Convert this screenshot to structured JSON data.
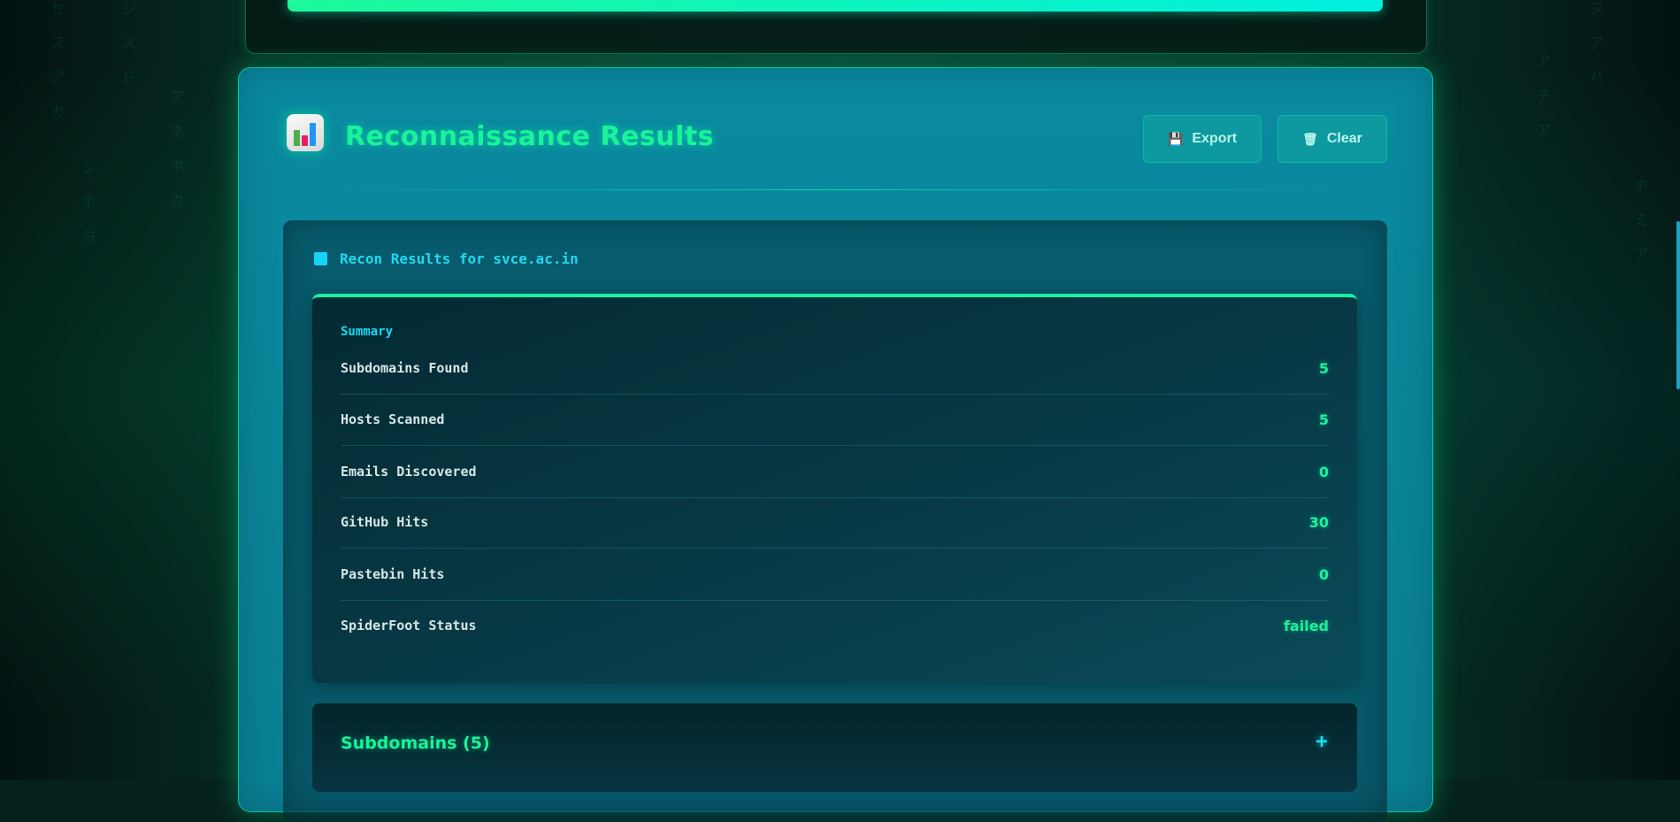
{
  "header": {
    "title": "Reconnaissance Results",
    "export_label": "Export",
    "clear_label": "Clear"
  },
  "results": {
    "heading": "Recon Results for svce.ac.in",
    "summary_label": "Summary",
    "rows": [
      {
        "label": "Subdomains Found",
        "value": "5"
      },
      {
        "label": "Hosts Scanned",
        "value": "5"
      },
      {
        "label": "Emails Discovered",
        "value": "0"
      },
      {
        "label": "GitHub Hits",
        "value": "30"
      },
      {
        "label": "Pastebin Hits",
        "value": "0"
      },
      {
        "label": "SpiderFoot Status",
        "value": "failed"
      }
    ]
  },
  "sections": {
    "subdomains_title": "Subdomains (5)",
    "toggle_symbol": "+"
  },
  "colors": {
    "accent_green": "#19f39a",
    "accent_cyan": "#19d8f2",
    "panel_bg": "#0a8aa0"
  },
  "icons": {
    "header_icon": "bar-chart-icon",
    "export_icon": "floppy-disk-icon",
    "clear_icon": "wastebasket-icon"
  }
}
